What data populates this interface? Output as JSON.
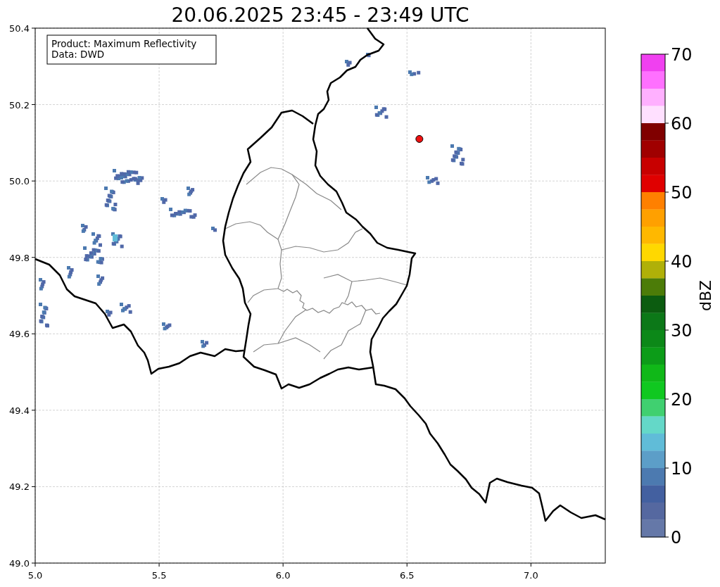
{
  "title": "20.06.2025 23:45 - 23:49 UTC",
  "map": {
    "legend": [
      "Product: Maximum Reflectivity",
      "Data: DWD"
    ],
    "chart_data": {
      "type": "scatter",
      "grid": true,
      "xlim": [
        5.0,
        7.3
      ],
      "ylim": [
        49.0,
        50.4
      ],
      "xticks": [
        {
          "value": 5,
          "label": "5.0"
        },
        {
          "value": 5.5,
          "label": "5.5"
        },
        {
          "value": 6,
          "label": "6.0"
        },
        {
          "value": 6.5,
          "label": "6.5"
        },
        {
          "value": 7,
          "label": "7.0"
        }
      ],
      "yticks": [
        {
          "value": 49,
          "label": "49.0"
        },
        {
          "value": 49.2,
          "label": "49.2"
        },
        {
          "value": 49.4,
          "label": "49.4"
        },
        {
          "value": 49.6,
          "label": "49.6"
        },
        {
          "value": 49.8,
          "label": "49.8"
        },
        {
          "value": 50,
          "label": "50.0"
        },
        {
          "value": 50.2,
          "label": "50.2"
        },
        {
          "value": 50.4,
          "label": "50.4"
        }
      ],
      "series": [
        {
          "color": "#ee1111",
          "x": [
            6.55
          ],
          "values": [
            50.11
          ]
        }
      ]
    }
  },
  "colorbar": {
    "label": "dBZ",
    "ticks": [
      "70",
      "60",
      "50",
      "40",
      "30",
      "20",
      "10",
      "0"
    ],
    "bands": [
      {
        "color": "#f040f0"
      },
      {
        "color": "#ff70ff"
      },
      {
        "color": "#ffb0ff"
      },
      {
        "color": "#ffe0ff"
      },
      {
        "color": "#800000"
      },
      {
        "color": "#a00000"
      },
      {
        "color": "#c80000"
      },
      {
        "color": "#e00000"
      },
      {
        "color": "#ff8000"
      },
      {
        "color": "#ffa000"
      },
      {
        "color": "#ffb800"
      },
      {
        "color": "#ffd800"
      },
      {
        "color": "#b0b008"
      },
      {
        "color": "#4c7c08"
      },
      {
        "color": "#0c5c10"
      },
      {
        "color": "#0c7818"
      },
      {
        "color": "#0c8818"
      },
      {
        "color": "#0c9c18"
      },
      {
        "color": "#10b818"
      },
      {
        "color": "#10c820"
      },
      {
        "color": "#40d070"
      },
      {
        "color": "#64d8c8"
      },
      {
        "color": "#60bcd8"
      },
      {
        "color": "#5c9ec8"
      },
      {
        "color": "#4c7ab0"
      },
      {
        "color": "#4360a0"
      },
      {
        "color": "#5568a0"
      },
      {
        "color": "#6578a8"
      }
    ]
  }
}
